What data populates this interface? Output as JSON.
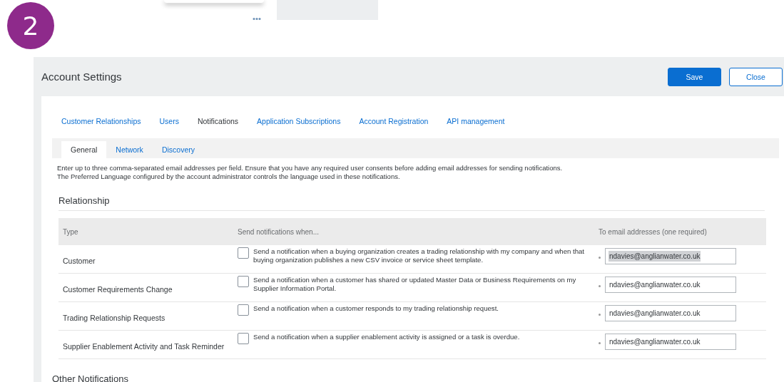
{
  "step_badge": "2",
  "window": {
    "title": "Account Settings"
  },
  "buttons": [
    {
      "label": "Save",
      "kind": "primary"
    },
    {
      "label": "Close",
      "kind": "secondary"
    }
  ],
  "tabs": [
    {
      "label": "Customer Relationships",
      "selected": false
    },
    {
      "label": "Users",
      "selected": false
    },
    {
      "label": "Notifications",
      "selected": true
    },
    {
      "label": "Application Subscriptions",
      "selected": false
    },
    {
      "label": "Account Registration",
      "selected": false
    },
    {
      "label": "API management",
      "selected": false
    }
  ],
  "subtabs": [
    {
      "label": "General",
      "selected": true
    },
    {
      "label": "Network",
      "selected": false
    },
    {
      "label": "Discovery",
      "selected": false
    }
  ],
  "description": [
    "Enter up to three comma-separated email addresses per field. Ensure that you have any required user consents before adding email addresses for sending notifications.",
    "The Preferred Language configured by the account administrator controls the language used in these notifications."
  ],
  "section": {
    "title": "Relationship",
    "columns": [
      "Type",
      "Send notifications when...",
      "To email addresses (one required)"
    ],
    "rows": [
      {
        "type": "Customer",
        "checked": false,
        "message": "Send a notification when a buying organization creates a trading relationship with my company and when that buying organization publishes a new CSV invoice or service sheet template.",
        "email": "ndavies@anglianwater.co.uk",
        "highlighted": true
      },
      {
        "type": "Customer Requirements Change",
        "checked": false,
        "message": "Send a notification when a customer has shared or updated Master Data or Business Requirements on my Supplier Information Portal.",
        "email": "ndavies@anglianwater.co.uk",
        "highlighted": false
      },
      {
        "type": "Trading Relationship Requests",
        "checked": false,
        "message": "Send a notification when a customer responds to my trading relationship request.",
        "email": "ndavies@anglianwater.co.uk",
        "highlighted": false
      },
      {
        "type": "Supplier Enablement Activity and Task Reminder",
        "checked": false,
        "message": "Send a notification when a supplier enablement activity is assigned or a task is overdue.",
        "email": "ndavies@anglianwater.co.uk",
        "highlighted": false
      }
    ]
  },
  "next_section": {
    "title": "Other Notifications"
  }
}
